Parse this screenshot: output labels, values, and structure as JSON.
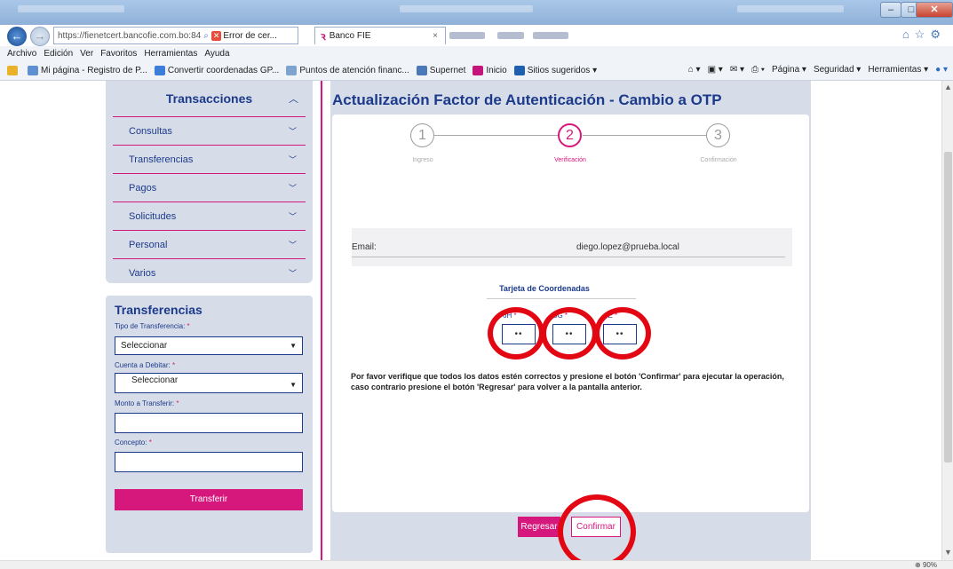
{
  "browser": {
    "address": "https://fienetcert.bancofie.com.bo:84",
    "cert_error": "Error de cer...",
    "tab_title": "Banco FIE",
    "menu": [
      "Archivo",
      "Edición",
      "Ver",
      "Favoritos",
      "Herramientas",
      "Ayuda"
    ],
    "favorites": [
      "Mi página - Registro de P...",
      "Convertir coordenadas GP...",
      "Puntos de atención financ...",
      "Supernet",
      "Inicio",
      "Sitios sugeridos ▾"
    ],
    "toolbar_right": [
      "Página ▾",
      "Seguridad ▾",
      "Herramientas ▾"
    ],
    "zoom": "90%"
  },
  "sidebar": {
    "header": "Transacciones",
    "items": [
      {
        "label": "Consultas"
      },
      {
        "label": "Transferencias"
      },
      {
        "label": "Pagos"
      },
      {
        "label": "Solicitudes"
      },
      {
        "label": "Personal"
      },
      {
        "label": "Varios"
      }
    ]
  },
  "transfer_form": {
    "title": "Transferencias",
    "tipo_label": "Tipo de Transferencia:",
    "tipo_value": "Seleccionar",
    "cuenta_label": "Cuenta a Debitar:",
    "cuenta_value": "Seleccionar",
    "monto_label": "Monto a Transferir:",
    "concepto_label": "Concepto:",
    "submit": "Transferir",
    "required_mark": "*"
  },
  "main": {
    "title": "Actualización Factor de Autenticación - Cambio a OTP",
    "steps": [
      {
        "num": "1",
        "label": "Ingreso"
      },
      {
        "num": "2",
        "label": "Verificación"
      },
      {
        "num": "3",
        "label": "Confirmación"
      }
    ],
    "active_step": 2,
    "email_label": "Email:",
    "email_value": "diego.lopez@prueba.local",
    "coord_title": "Tarjeta de Coordenadas",
    "coords": [
      {
        "label": "6H",
        "value": "••"
      },
      {
        "label": "5G",
        "value": "••"
      },
      {
        "label": "6E",
        "value": "••"
      }
    ],
    "notice": "Por favor verifique que todos los datos estén correctos y presione el botón 'Confirmar' para ejecutar la operación, caso contrario presione el botón 'Regresar' para volver a la pantalla anterior.",
    "back_button": "Regresar",
    "confirm_button": "Confirmar"
  },
  "colors": {
    "brand_pink": "#d6187d",
    "brand_blue": "#1b3a8c",
    "highlight_ring": "#e30613"
  }
}
